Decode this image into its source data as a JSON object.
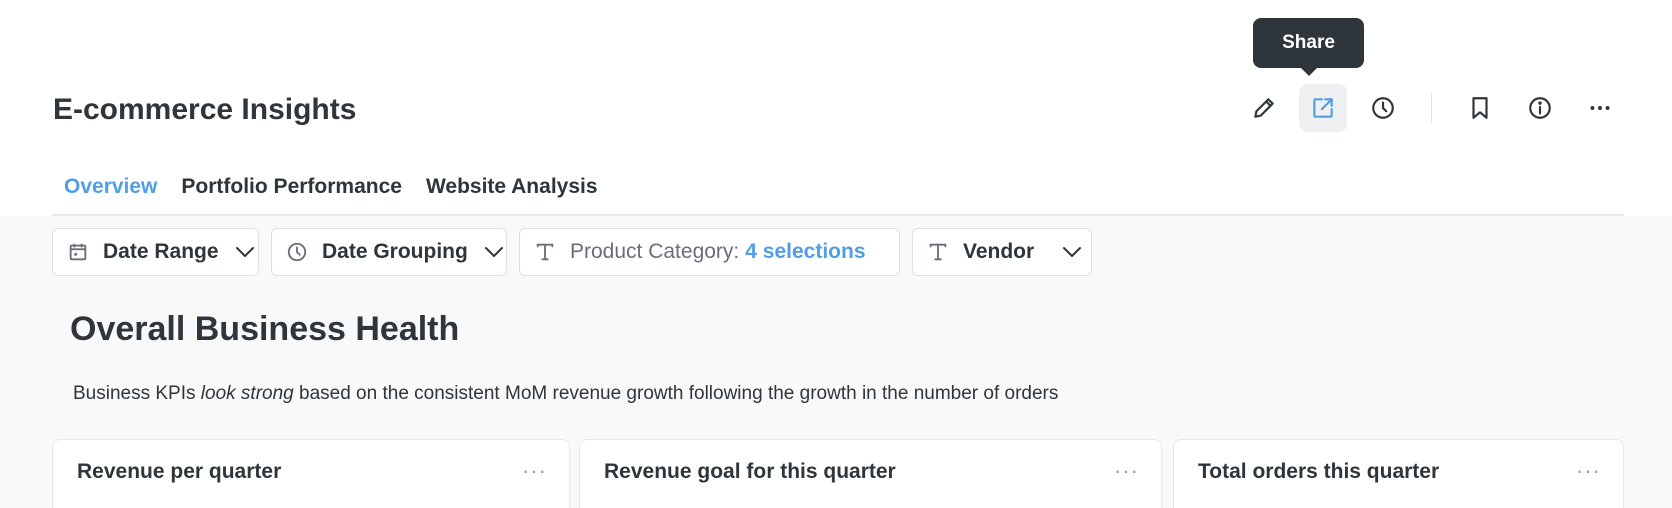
{
  "header": {
    "title": "E-commerce Insights",
    "tooltip": "Share",
    "actions": [
      {
        "name": "edit-icon",
        "active": false
      },
      {
        "name": "share-icon",
        "active": true
      },
      {
        "name": "history-icon",
        "active": false
      },
      {
        "name": "bookmark-icon",
        "active": false
      },
      {
        "name": "info-icon",
        "active": false
      },
      {
        "name": "more-icon",
        "active": false
      }
    ]
  },
  "tabs": [
    {
      "label": "Overview",
      "active": true
    },
    {
      "label": "Portfolio Performance",
      "active": false
    },
    {
      "label": "Website Analysis",
      "active": false
    }
  ],
  "filters": {
    "date_range": {
      "label": "Date Range",
      "icon": "calendar-icon"
    },
    "date_grouping": {
      "label": "Date Grouping",
      "icon": "clock-icon"
    },
    "product_category": {
      "label": "Product Category:",
      "selection": "4 selections",
      "icon": "text-icon"
    },
    "vendor": {
      "label": "Vendor",
      "icon": "text-icon"
    }
  },
  "section": {
    "title": "Overall Business Health",
    "desc_before": "Business KPIs ",
    "desc_emphasis": "look strong",
    "desc_after": " based on the consistent MoM revenue growth following the growth in the number of orders"
  },
  "cards": [
    {
      "title": "Revenue per quarter",
      "menu": "···"
    },
    {
      "title": "Revenue goal for this quarter",
      "menu": "···"
    },
    {
      "title": "Total orders this quarter",
      "menu": "···"
    }
  ],
  "colors": {
    "accent": "#509ee3",
    "text": "#2e353b",
    "tooltip_bg": "#2e353b",
    "content_bg": "#f9f9fa"
  }
}
